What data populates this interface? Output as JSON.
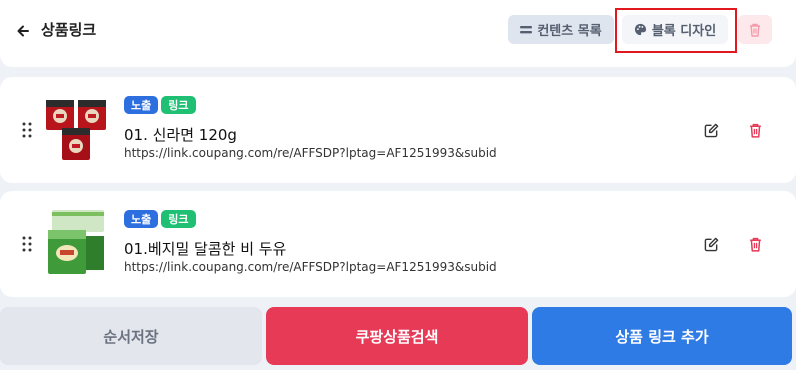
{
  "header": {
    "title": "상품링크",
    "contents_label": "컨텐츠 목록",
    "design_label": "블록 디자인"
  },
  "items": [
    {
      "badge_expose": "노출",
      "badge_link": "링크",
      "title": "01. 신라면 120g",
      "url": "https://link.coupang.com/re/AFFSDP?lptag=AF1251993&subid"
    },
    {
      "badge_expose": "노출",
      "badge_link": "링크",
      "title": "01.베지밀 달콤한 비 두유",
      "url": "https://link.coupang.com/re/AFFSDP?lptag=AF1251993&subid"
    }
  ],
  "footer": {
    "save_label": "순서저장",
    "search_label": "쿠팡상품검색",
    "add_label": "상품 링크 추가"
  },
  "colors": {
    "expose_badge": "#2e6fe0",
    "link_badge": "#1fbf74",
    "search_button": "#e63a57",
    "add_button": "#2f7be6",
    "highlight": "#e3171e"
  },
  "icons": [
    "arrow-left-icon",
    "list-icon",
    "palette-icon",
    "trash-icon",
    "drag-handle-icon",
    "edit-icon"
  ]
}
